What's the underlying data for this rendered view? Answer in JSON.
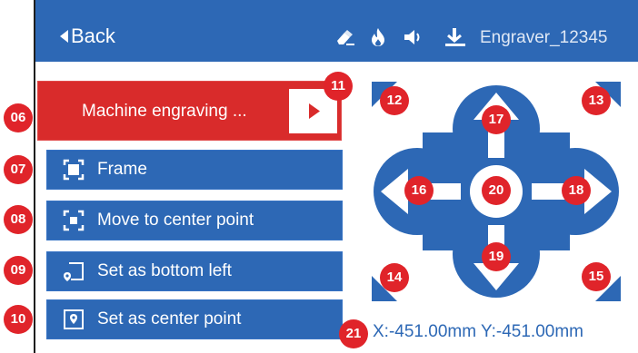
{
  "header": {
    "back_label": "Back",
    "device_name": "Engraver_12345",
    "status_icons": [
      "eraser-icon",
      "flame-icon",
      "speaker-icon",
      "laser-focus-icon"
    ]
  },
  "actions": {
    "engrave_label": "Machine engraving ...",
    "frame_label": "Frame",
    "move_center_label": "Move to center point",
    "set_bottom_left_label": "Set as bottom left",
    "set_center_label": "Set as center point"
  },
  "badges": {
    "b06": "06",
    "b07": "07",
    "b08": "08",
    "b09": "09",
    "b10": "10",
    "b11": "11",
    "b12": "12",
    "b13": "13",
    "b14": "14",
    "b15": "15",
    "b16": "16",
    "b17": "17",
    "b18": "18",
    "b19": "19",
    "b20": "20",
    "b21": "21"
  },
  "position": {
    "text": "X:-451.00mm Y:-451.00mm"
  },
  "colors": {
    "header": "#2d68b5",
    "button": "#2d68b5",
    "engrave": "#d92b2b",
    "badge": "#e0242a"
  }
}
